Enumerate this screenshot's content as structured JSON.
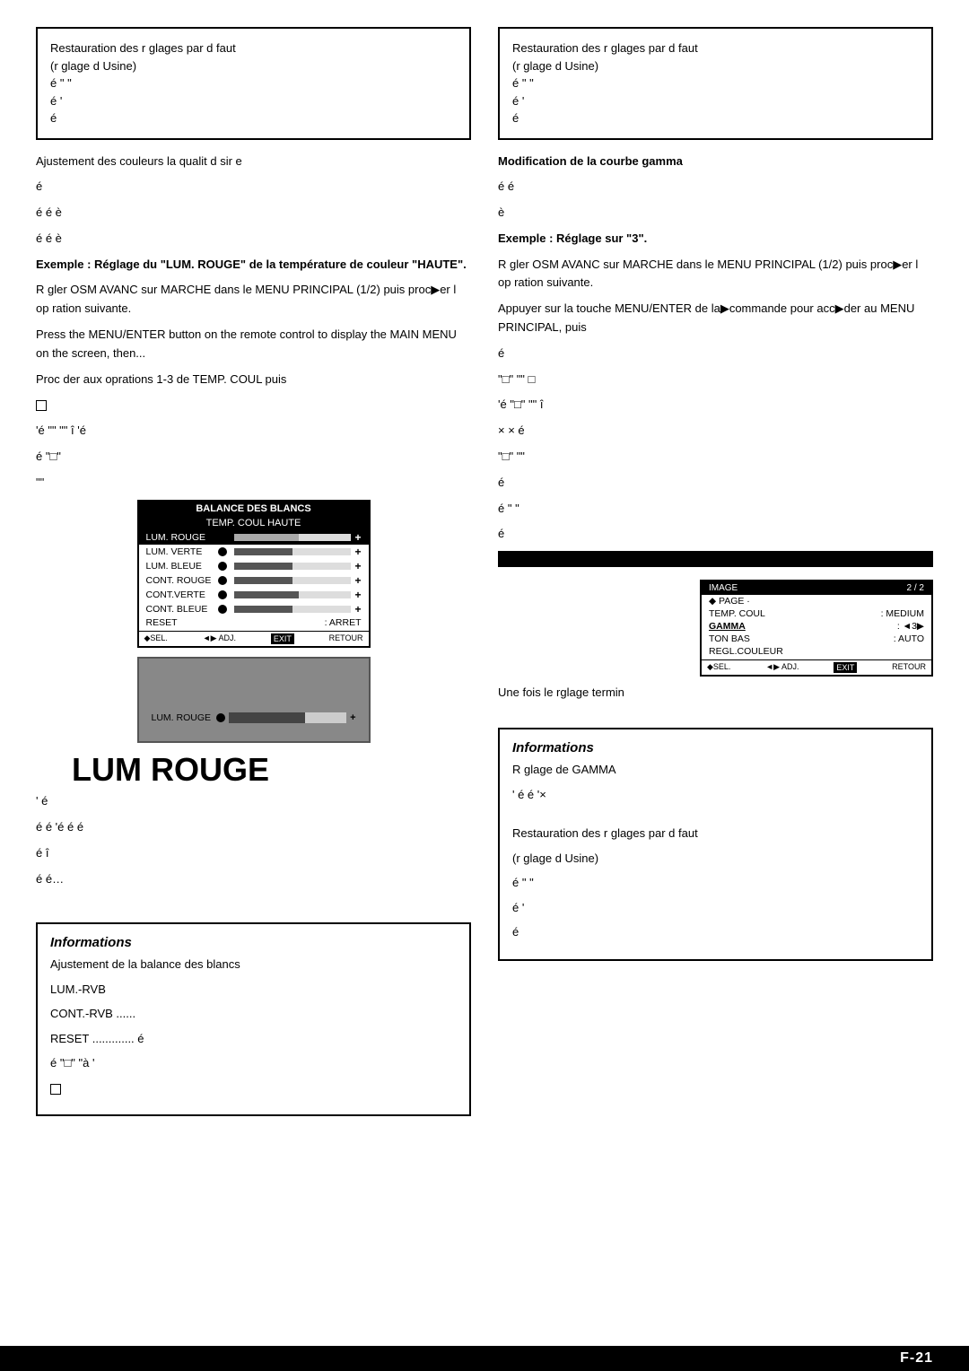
{
  "page": {
    "page_number": "F-21"
  },
  "left_col": {
    "info_box_top": {
      "line1": "Restauration des r    glages par d     faut",
      "line2": "(r  glage d   Usine)",
      "line3": "é    \"    \"",
      "line4": "é      '",
      "line5": "é"
    },
    "section1": {
      "text": "Ajustement des couleurs      la qualit   d sir  e",
      "text2": "é",
      "text3": "é    é          è",
      "text4": "é é   è"
    },
    "example_title": "Exemple : Réglage du \"LUM. ROUGE\" de la température de couleur \"HAUTE\".",
    "instruction1": "R gler  OSM AVANC   sur  MARCHE  dans le MENU PRINCIPAL (1/2) puis proc▶er   l op ration suivante.",
    "instruction2": "Press the MENU/ENTER button on the remote control to display the MAIN MENU on the screen, then...",
    "instruction3": "Proc der aux oprations 1-3 de TEMP. COUL puis",
    "checkbox_line": "□",
    "text_block1": "'é  \"\"         \"\"  î   'é",
    "text_block2": "é   \"□\"",
    "text_block3": "\"\"",
    "menu": {
      "title": "BALANCE DES BLANCS",
      "subtitle": "TEMP. COUL HAUTE",
      "rows": [
        {
          "label": "LUM. ROUGE",
          "selected": true,
          "fill": 55
        },
        {
          "label": "LUM. VERTE",
          "selected": false,
          "fill": 50
        },
        {
          "label": "LUM. BLEUE",
          "selected": false,
          "fill": 50
        },
        {
          "label": "CONT. ROUGE",
          "selected": false,
          "fill": 50
        },
        {
          "label": "CONT.VERTE",
          "selected": false,
          "fill": 55
        },
        {
          "label": "CONT. BLEUE",
          "selected": false,
          "fill": 50
        }
      ],
      "reset_label": "RESET",
      "reset_value": ":  ARRET",
      "nav": {
        "sel": "◆SEL.",
        "adj": "◄▶ ADJ.",
        "exit": "EXIT",
        "retour": "RETOUR"
      }
    },
    "lum_rouge_screen": {
      "label": "LUM. ROUGE",
      "bar_fill": 65
    },
    "text_after": "'   é",
    "text_after2": "é   é  'é   é é",
    "text_after3": "é  î",
    "text_after4": "é      é…",
    "info_box_bottom": {
      "title": "Informations",
      "line1": "Ajustement de la balance des blancs",
      "lum_rvb": "LUM.-RVB",
      "cont_rvb": "CONT.-RVB ......",
      "reset": "RESET .............      é",
      "text1": "é   \"□\"   \"à '",
      "checkbox": "□"
    }
  },
  "right_col": {
    "info_box_top": {
      "line1": "Restauration des r    glages par d     faut",
      "line2": "(r  glage d   Usine)",
      "line3": "é    \"    \"",
      "line4": "é      '",
      "line5": "é"
    },
    "section_gamma": {
      "title": "Modification de la courbe gamma",
      "text1": "é      é",
      "text2": "è"
    },
    "example_title": "Exemple : Réglage sur \"3\".",
    "instruction1": "R gler  OSM AVANC   sur  MARCHE  dans le MENU PRINCIPAL (1/2) puis proc▶er   l op ration suivante.",
    "instruction2": "Appuyer sur la touche MENU/ENTER de la▶commande pour acc▶der au MENU PRINCIPAL, puis",
    "text_block1": "é",
    "text_block2": "\"□\"   \"\"   □",
    "text_block3": "'é  \"□\"   \"\"  î",
    "text_block4": "×         é",
    "text_block5": "\"□\"   \"\"",
    "text_block6": "é",
    "text_block7": "é     \"  \"",
    "text_block8": "é",
    "black_bar": "████████████████████████",
    "menu2": {
      "title": "IMAGE",
      "page": "2 / 2",
      "page_label": "◆ PAGE ·",
      "rows": [
        {
          "label": "TEMP. COUL",
          "colon": ":",
          "value": "MEDIUM"
        },
        {
          "label": "GAMMA",
          "colon": ":",
          "value": "◄3▶",
          "underline": true
        },
        {
          "label": "TON BAS",
          "colon": ":",
          "value": "AUTO"
        },
        {
          "label": "REGL.COULEUR",
          "colon": "",
          "value": ""
        }
      ],
      "nav": {
        "sel": "◆SEL.",
        "adj": "◄▶ ADJ.",
        "exit": "EXIT",
        "retour": "RETOUR"
      }
    },
    "text_done": "Une fois le rglage termin",
    "info_box_bottom": {
      "title": "Informations",
      "line1": "R  glage de GAMMA",
      "line2": "'   é    é          '×",
      "blank": "",
      "line3": "Restauration des r    glages par d     faut",
      "line4": "(r  glage d   Usine)",
      "line5": "é    \"    \"",
      "line6": "é      '",
      "line7": "é"
    }
  }
}
